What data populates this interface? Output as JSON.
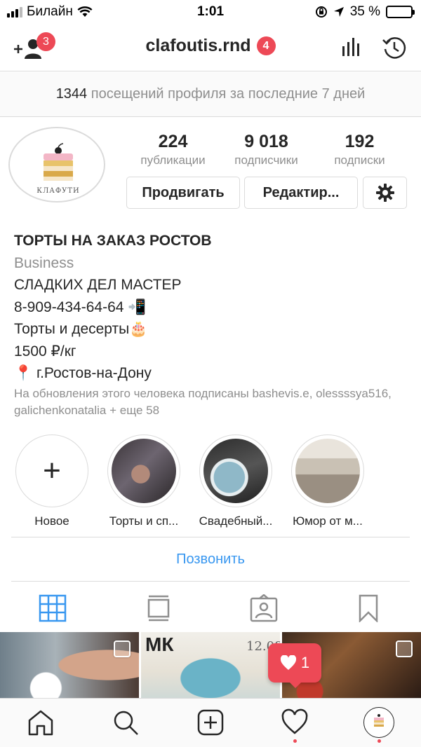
{
  "status_bar": {
    "carrier": "Билайн",
    "time": "1:01",
    "battery_percent": "35 %",
    "battery_level": 0.35,
    "icons": [
      "signal-icon",
      "wifi-icon",
      "rotation-lock-icon",
      "location-arrow-icon",
      "battery-icon"
    ]
  },
  "nav": {
    "username": "clafoutis.rnd",
    "username_badge": "4",
    "add_person_badge": "3",
    "icons": [
      "add-person-icon",
      "insights-icon",
      "history-icon"
    ]
  },
  "visits": {
    "count": "1344",
    "text": "посещений профиля за последние 7 дней"
  },
  "profile": {
    "avatar_brand": "КЛАФУТИ",
    "stats": [
      {
        "value": "224",
        "label": "публикации"
      },
      {
        "value": "9 018",
        "label": "подписчики"
      },
      {
        "value": "192",
        "label": "подписки"
      }
    ],
    "buttons": {
      "promote": "Продвигать",
      "edit": "Редактир..."
    },
    "bio": {
      "name": "ТОРТЫ НА ЗАКАЗ РОСТОВ",
      "category": "Business",
      "line1": "СЛАДКИХ ДЕЛ МАСТЕР",
      "line2": "8-909-434-64-64 📲",
      "line3": "Торты и десерты🎂",
      "line4": "1500 ₽/кг",
      "line5": "📍 г.Ростов-на-Дону"
    },
    "followed_by": "На обновления этого человека подписаны bashevis.e, olessssya516, galichenkonatalia + еще 58"
  },
  "highlights": [
    {
      "label": "Новое"
    },
    {
      "label": "Торты и сп..."
    },
    {
      "label": "Свадебный..."
    },
    {
      "label": "Юмор от м..."
    }
  ],
  "call_button": "Позвонить",
  "tabs": [
    "grid-icon",
    "feed-icon",
    "tagged-icon",
    "saved-icon"
  ],
  "posts": {
    "mk_text": "МК",
    "date_text": "12.08"
  },
  "notification": {
    "likes": "1"
  },
  "bottom_nav": [
    "home-icon",
    "search-icon",
    "new-post-icon",
    "activity-icon",
    "profile-icon"
  ],
  "colors": {
    "accent": "#3897f0",
    "badge": "#ed4956",
    "muted": "#8e8e8e",
    "border": "#dbdbdb",
    "battery": "#f7c500"
  }
}
